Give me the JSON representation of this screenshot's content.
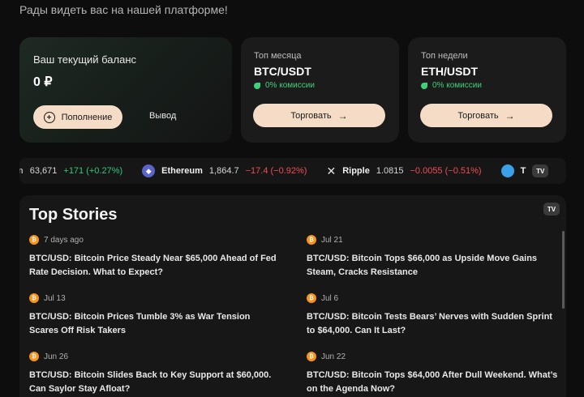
{
  "welcome": "Рады видеть вас на нашей платформе!",
  "balance": {
    "label": "Ваш текущий баланс",
    "value": "0 ₽",
    "deposit_label": "Пополнение",
    "withdraw_label": "Вывод"
  },
  "top_cards": [
    {
      "label": "Топ месяца",
      "pair": "BTC/USDT",
      "fee": "0% комиссии",
      "button": "Торговать"
    },
    {
      "label": "Топ недели",
      "pair": "ETH/USDT",
      "fee": "0% комиссии",
      "button": "Торговать"
    }
  ],
  "ticker": {
    "items": [
      {
        "name": "",
        "price": "63,671",
        "change": "+171 (+0.27%)",
        "direction": "up"
      },
      {
        "name": "Ethereum",
        "price": "1,864.7",
        "change": "−17.4 (−0.92%)",
        "direction": "down",
        "icon": "ethereum-icon"
      },
      {
        "name": "Ripple",
        "price": "1.0815",
        "change": "−0.0055 (−0.51%)",
        "direction": "down",
        "icon": "x-icon"
      },
      {
        "name": "T",
        "price": "",
        "change": "",
        "direction": "",
        "icon": "toncoin-icon"
      }
    ],
    "badge": "TV"
  },
  "stories": {
    "title": "Top Stories",
    "badge": "TV",
    "items": [
      {
        "date": "7 days ago",
        "headline": "BTC/USD: Bitcoin Price Steady Near $65,000 Ahead of Fed Rate Decision. What to Expect?"
      },
      {
        "date": "Jul 21",
        "headline": "BTC/USD: Bitcoin Tops $66,000 as Upside Move Gains Steam, Cracks Resistance"
      },
      {
        "date": "Jul 13",
        "headline": "BTC/USD: Bitcoin Prices Tumble 3% as War Tension Scares Off Risk Takers"
      },
      {
        "date": "Jul 6",
        "headline": "BTC/USD: Bitcoin Tests Bears’ Nerves with Sudden Sprint to $64,000. Can It Last?"
      },
      {
        "date": "Jun 26",
        "headline": "BTC/USD: Bitcoin Slides Back to Key Support at $60,000. Can Saylor Stay Afloat?"
      },
      {
        "date": "Jun 22",
        "headline": "BTC/USD: Bitcoin Tops $64,000 After Dull Weekend. What’s on the Agenda Now?"
      }
    ]
  },
  "colors": {
    "accent_button": "#f5dcc6",
    "positive": "#34c77b",
    "negative": "#ef4d56",
    "fee_green": "#3fd17a"
  }
}
